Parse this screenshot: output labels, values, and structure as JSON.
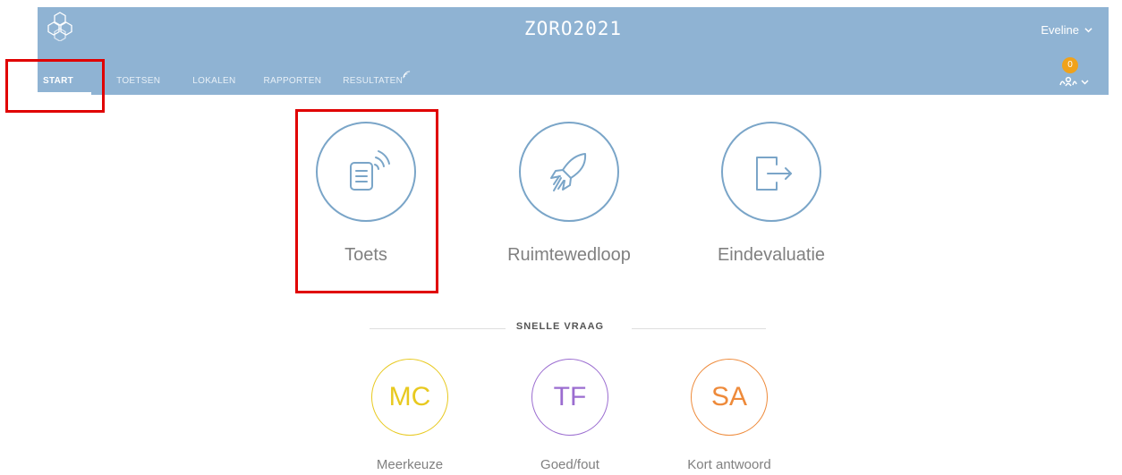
{
  "header": {
    "room_code": "ZORO2021",
    "user_name": "Eveline",
    "notification_count": "0",
    "background_color": "#8fb3d3"
  },
  "nav": {
    "tabs": [
      {
        "label": "START",
        "active": true
      },
      {
        "label": "TOETSEN",
        "active": false
      },
      {
        "label": "LOKALEN",
        "active": false
      },
      {
        "label": "RAPPORTEN",
        "active": false
      },
      {
        "label": "RESULTATEN",
        "active": false
      }
    ]
  },
  "tiles": [
    {
      "label": "Toets",
      "icon": "test-document-wireless-icon"
    },
    {
      "label": "Ruimtewedloop",
      "icon": "rocket-icon"
    },
    {
      "label": "Eindevaluatie",
      "icon": "exit-arrow-icon"
    }
  ],
  "quick_question": {
    "heading": "SNELLE VRAAG",
    "items": [
      {
        "abbr": "MC",
        "label": "Meerkeuze",
        "color": "#e8c91f"
      },
      {
        "abbr": "TF",
        "label": "Goed/fout",
        "color": "#9b6dd0"
      },
      {
        "abbr": "SA",
        "label": "Kort antwoord",
        "color": "#ee8a3a"
      }
    ]
  },
  "colors": {
    "accent_line": "#7aa5c8",
    "highlight_box": "#e00000",
    "badge": "#f0a21b"
  }
}
